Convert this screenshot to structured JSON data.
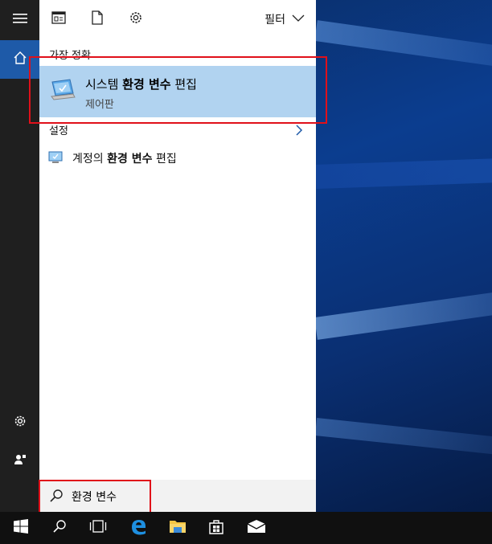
{
  "toolbar": {
    "filter_label": "필터"
  },
  "sections": {
    "best_match": "가장 정확",
    "settings": "설정"
  },
  "best_match": {
    "title_plain": "시스템 ",
    "title_bold": "환경 변수",
    "title_end": " 편집",
    "subtitle": "제어판"
  },
  "settings_result": {
    "prefix": "계정의 ",
    "bold": "환경 변수",
    "suffix": " 편집"
  },
  "search": {
    "query": "환경 변수"
  },
  "colors": {
    "rail_active": "#1e5aa8",
    "best_match_bg": "#b1d3f0",
    "highlight_box": "#e0101a",
    "taskbar_bg": "#101010"
  },
  "icons": {
    "rail": [
      "hamburger-menu-icon",
      "home-icon",
      "gear-icon",
      "user-icon"
    ],
    "toolbar": [
      "apps-icon",
      "document-icon",
      "settings-icon",
      "chevron-down-icon"
    ],
    "taskbar": [
      "windows-icon",
      "search-icon",
      "task-view-icon",
      "edge-icon",
      "file-explorer-icon",
      "store-icon",
      "mail-icon"
    ]
  }
}
